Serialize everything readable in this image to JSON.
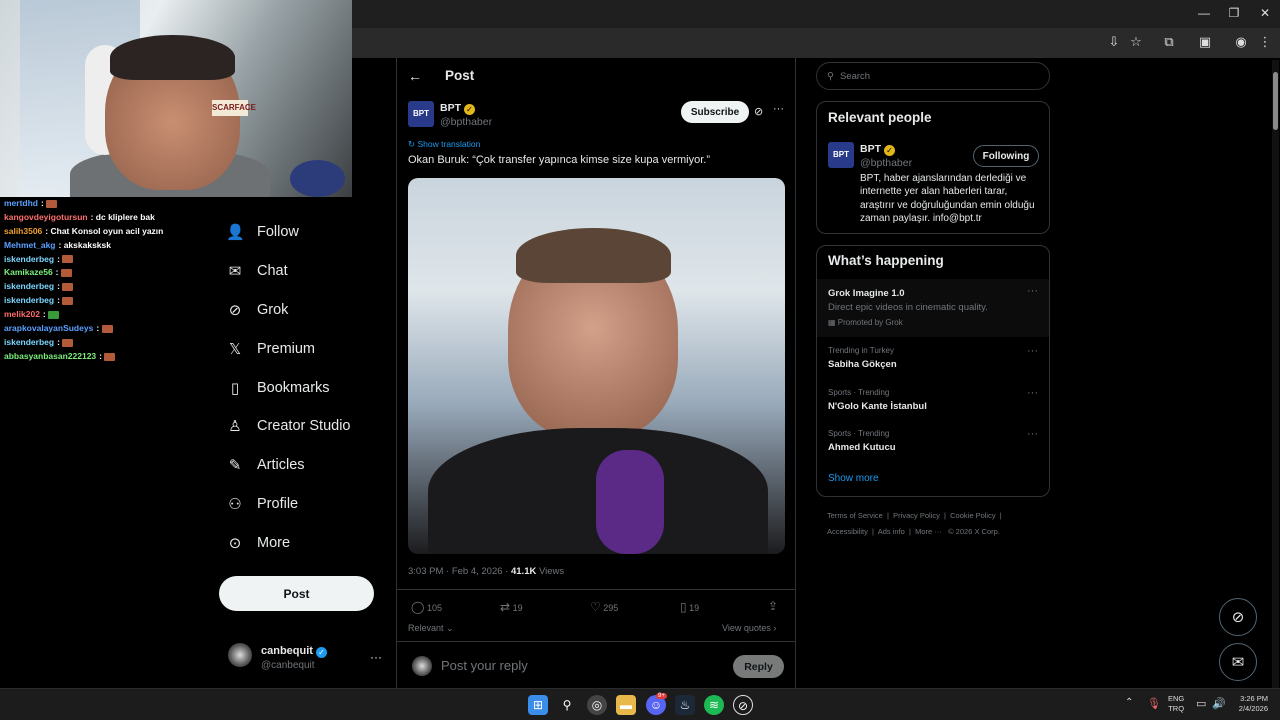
{
  "chat": [
    {
      "user": "mertdhd",
      "color": "#5aa0ff",
      "msg": "",
      "emote": "brown"
    },
    {
      "user": "kangovdeyigotursun",
      "color": "#ff7070",
      "msg": "dc kliplere bak",
      "emote": ""
    },
    {
      "user": "salih3506",
      "color": "#f0a030",
      "msg": "Chat Konsol oyun acil yazın",
      "emote": ""
    },
    {
      "user": "Mehmet_akg",
      "color": "#5aa0ff",
      "msg": "akskaksksk",
      "emote": ""
    },
    {
      "user": "iskenderbeg",
      "color": "#7cd7ff",
      "msg": "",
      "emote": "brown"
    },
    {
      "user": "Kamikaze56",
      "color": "#7cf07c",
      "msg": "",
      "emote": "brown"
    },
    {
      "user": "iskenderbeg",
      "color": "#7cd7ff",
      "msg": "",
      "emote": "brown"
    },
    {
      "user": "iskenderbeg",
      "color": "#7cd7ff",
      "msg": "",
      "emote": "brown"
    },
    {
      "user": "melik202",
      "color": "#ff6a6a",
      "msg": "",
      "emote": "green"
    },
    {
      "user": "arapkovalayanSudeys",
      "color": "#5aa0ff",
      "msg": "",
      "emote": "brown"
    },
    {
      "user": "iskenderbeg",
      "color": "#7cd7ff",
      "msg": "",
      "emote": "brown"
    },
    {
      "user": "abbasyanbasan222123",
      "color": "#7cf07c",
      "msg": "",
      "emote": "brown"
    }
  ],
  "webcam_sign": "SCARFACE",
  "nav": {
    "follow": "Follow",
    "chat": "Chat",
    "grok": "Grok",
    "premium": "Premium",
    "bookmarks": "Bookmarks",
    "creator_studio": "Creator Studio",
    "articles": "Articles",
    "profile": "Profile",
    "more": "More",
    "post_button": "Post"
  },
  "account": {
    "name": "canbequit",
    "handle": "@canbequit"
  },
  "post": {
    "header": "Post",
    "author": "BPT",
    "handle": "@bpthaber",
    "author_logo": "BPT",
    "subscribe": "Subscribe",
    "show_translation": "Show translation",
    "text": "Okan Buruk: “Çok transfer yapınca kimse size kupa vermiyor.”",
    "time": "3:03 PM · Feb 4, 2026 ·",
    "views_count": "41.1K",
    "views_label": "Views",
    "replies": "105",
    "reposts": "19",
    "likes": "295",
    "bookmarks": "19",
    "relevant": "Relevant",
    "view_quotes": "View quotes",
    "reply_placeholder": "Post your reply",
    "reply_button": "Reply"
  },
  "search_placeholder": "Search",
  "relevant_people": {
    "title": "Relevant people",
    "name": "BPT",
    "handle": "@bpthaber",
    "following": "Following",
    "bio": "BPT, haber ajanslarından derlediği ve internette yer alan haberleri tarar, araştırır ve doğruluğundan emin olduğu zaman paylaşır. info@bpt.tr"
  },
  "happening": {
    "title": "What’s happening",
    "promo_title": "Grok Imagine 1.0",
    "promo_sub": "Direct epic videos in cinematic quality.",
    "promo_by": "Promoted by Grok",
    "trends": [
      {
        "context": "Trending in Turkey",
        "name": "Sabiha Gökçen"
      },
      {
        "context": "Sports · Trending",
        "name": "N'Golo Kante İstanbul"
      },
      {
        "context": "Sports · Trending",
        "name": "Ahmed Kutucu"
      }
    ],
    "show_more": "Show more"
  },
  "footer": {
    "tos": "Terms of Service",
    "privacy": "Privacy Policy",
    "cookie": "Cookie Policy",
    "accessibility": "Accessibility",
    "ads": "Ads info",
    "more": "More ···",
    "copyright": "© 2026 X Corp."
  },
  "taskbar": {
    "lang1": "ENG",
    "lang2": "TRQ",
    "time": "3:26 PM",
    "date": "2/4/2026",
    "discord_badge": "9+"
  },
  "colors": {
    "accent": "#1d9bf0",
    "verified_gold": "#e2b719",
    "background": "#000000"
  }
}
